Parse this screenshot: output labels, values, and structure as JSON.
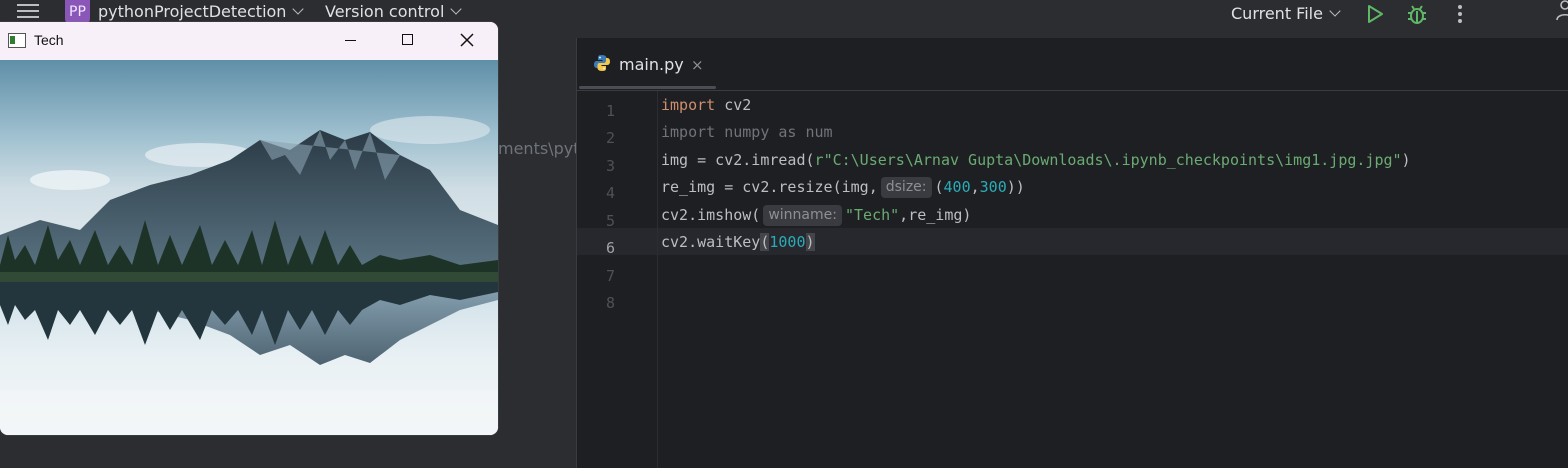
{
  "topbar": {
    "project_badge": "PP",
    "project_name": "pythonProjectDetection",
    "version_control": "Version control",
    "run_config": "Current File"
  },
  "project_pane": {
    "path_fragment": "ments\\pyt"
  },
  "editor": {
    "tab": {
      "label": "main.py",
      "close": "×"
    },
    "line_numbers": [
      "1",
      "2",
      "3",
      "4",
      "5",
      "6",
      "7",
      "8"
    ],
    "current_line": 6,
    "lines": {
      "l1_kw": "import",
      "l1_rest": " cv2",
      "l2": "import numpy as num",
      "l3_a": "img = cv2.imread(",
      "l3_r": "r",
      "l3_str": "\"C:\\Users\\Arnav Gupta\\Downloads\\.ipynb_checkpoints\\img1.jpg.jpg\"",
      "l3_b": ")",
      "l4_a": "re_img = cv2.resize(img,",
      "l4_hint": "dsize:",
      "l4_b": "(",
      "l4_n1": "400",
      "l4_c": ",",
      "l4_n2": "300",
      "l4_d": "))",
      "l5_a": "cv2.imshow(",
      "l5_hint": "winname:",
      "l5_str": "\"Tech\"",
      "l5_b": ",re_img)",
      "l6_a": "cv2.waitKey",
      "l6_open": "(",
      "l6_num": "1000",
      "l6_close": ")"
    }
  },
  "cv_window": {
    "title": "Tech"
  },
  "colors": {
    "keyword": "#cf8e6d",
    "string": "#6aab73",
    "number": "#2aacb8",
    "badge": "#8a56b8",
    "run_green": "#5fb865"
  }
}
